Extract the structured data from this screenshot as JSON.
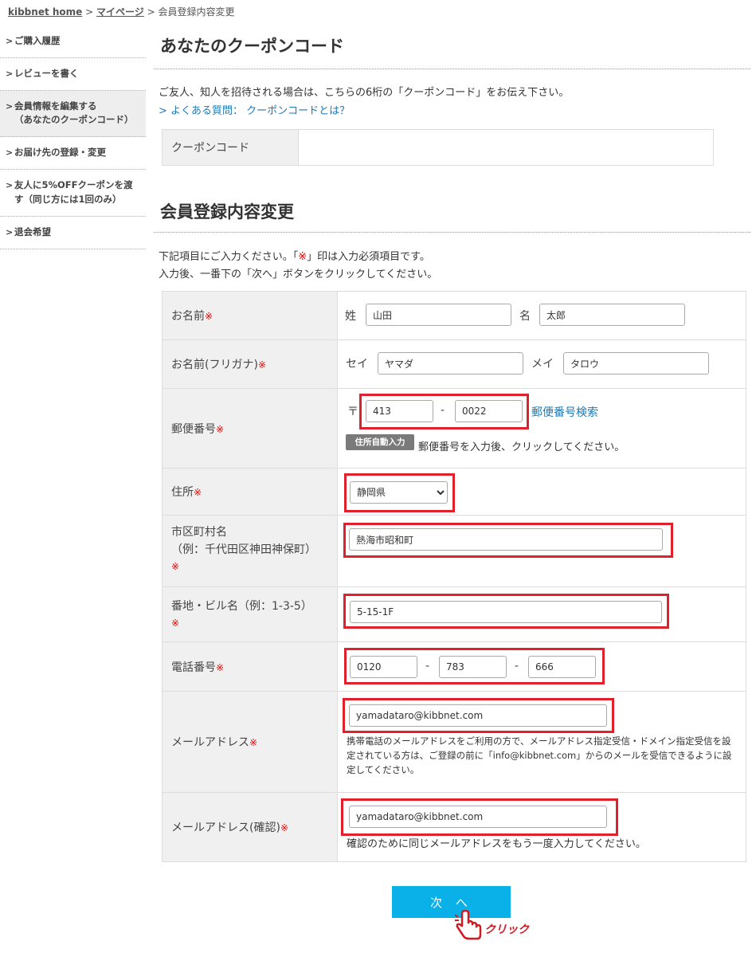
{
  "breadcrumb": {
    "home": "kibbnet home",
    "sep1": ">",
    "mypage": "マイページ",
    "sep2": ">",
    "current": "会員登録内容変更"
  },
  "sidebar": {
    "items": [
      {
        "label": "ご購入履歴"
      },
      {
        "label": "レビューを書く"
      },
      {
        "label": "会員情報を編集する",
        "sub": "（あなたのクーポンコード）",
        "active": true
      },
      {
        "label": "お届け先の登録・変更"
      },
      {
        "label": "友人に5%OFFクーポンを渡",
        "sub": "す（同じ方には1回のみ）"
      },
      {
        "label": "退会希望"
      }
    ],
    "arrow": ">"
  },
  "coupon": {
    "title": "あなたのクーポンコード",
    "text": "ご友人、知人を招待される場合は、こちらの6桁の「クーポンコード」をお伝え下さい。",
    "faq_link": "> よくある質問： クーポンコードとは？",
    "label": "クーポンコード",
    "value": ""
  },
  "member": {
    "title": "会員登録内容変更",
    "intro1_a": "下記項目にご入力ください。「",
    "intro1_mark": "※",
    "intro1_b": "」印は入力必須項目です。",
    "intro2": "入力後、一番下の「次へ」ボタンをクリックしてください。",
    "required_mark": "※"
  },
  "form": {
    "name": {
      "label": "お名前",
      "sei_label": "姓",
      "sei": "山田",
      "mei_label": "名",
      "mei": "太郎"
    },
    "kana": {
      "label": "お名前(フリガナ)",
      "sei_label": "セイ",
      "sei": "ヤマダ",
      "mei_label": "メイ",
      "mei": "タロウ"
    },
    "zip": {
      "label": "郵便番号",
      "symbol": "〒",
      "part1": "413",
      "dash": "-",
      "part2": "0022",
      "search_link": "郵便番号検索",
      "auto_button": "住所自動入力",
      "auto_hint": "郵便番号を入力後、クリックしてください。"
    },
    "pref": {
      "label": "住所",
      "selected": "静岡県"
    },
    "city": {
      "label": "市区町村名",
      "example": "（例：千代田区神田神保町）",
      "value": "熱海市昭和町"
    },
    "street": {
      "label": "番地・ビル名（例：1-3-5）",
      "value": "5-15-1F"
    },
    "tel": {
      "label": "電話番号",
      "part1": "0120",
      "dash": "-",
      "part2": "783",
      "part3": "666"
    },
    "email": {
      "label": "メールアドレス",
      "value": "yamadataro@kibbnet.com",
      "hint": "携帯電話のメールアドレスをご利用の方で、メールアドレス指定受信・ドメイン指定受信を設定されている方は、ご登録の前に「info@kibbnet.com」からのメールを受信できるように設定してください。"
    },
    "email_confirm": {
      "label": "メールアドレス(確認)",
      "value": "yamadataro@kibbnet.com",
      "hint": "確認のために同じメールアドレスをもう一度入力してください。"
    }
  },
  "next_button": "次 へ",
  "click_hint": "クリック",
  "colors": {
    "highlight": "#e0202a",
    "button": "#0ab0e8",
    "link": "#1a7ab8",
    "required": "#e00000"
  }
}
